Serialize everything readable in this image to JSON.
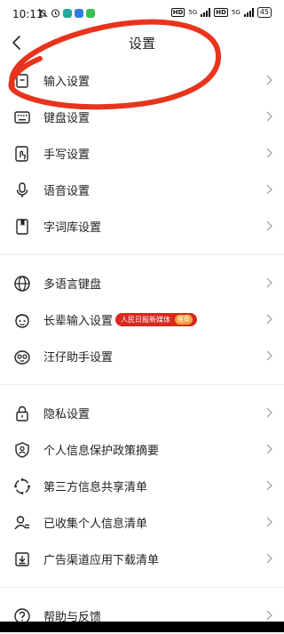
{
  "status_bar": {
    "time": "10:11",
    "network_1": "5G",
    "network_2": "5G",
    "battery": "45"
  },
  "header": {
    "title": "设置"
  },
  "groups": [
    [
      {
        "label": "输入设置",
        "icon": "input-settings-icon"
      },
      {
        "label": "键盘设置",
        "icon": "keyboard-icon"
      },
      {
        "label": "手写设置",
        "icon": "handwriting-icon"
      },
      {
        "label": "语音设置",
        "icon": "microphone-icon"
      },
      {
        "label": "字词库设置",
        "icon": "dictionary-icon"
      }
    ],
    [
      {
        "label": "多语言键盘",
        "icon": "globe-icon"
      },
      {
        "label": "长辈输入设置",
        "icon": "elder-face-icon",
        "badge": "人民日报新媒体",
        "badge_tag": "推荐"
      },
      {
        "label": "汪仔助手设置",
        "icon": "assistant-face-icon"
      }
    ],
    [
      {
        "label": "隐私设置",
        "icon": "lock-icon"
      },
      {
        "label": "个人信息保护政策摘要",
        "icon": "shield-user-icon"
      },
      {
        "label": "第三方信息共享清单",
        "icon": "share-cycle-icon"
      },
      {
        "label": "已收集个人信息清单",
        "icon": "user-list-icon"
      },
      {
        "label": "广告渠道应用下载清单",
        "icon": "download-icon"
      }
    ],
    [
      {
        "label": "帮助与反馈",
        "icon": "help-icon"
      }
    ]
  ],
  "annotation": {
    "color": "#e8341c"
  }
}
